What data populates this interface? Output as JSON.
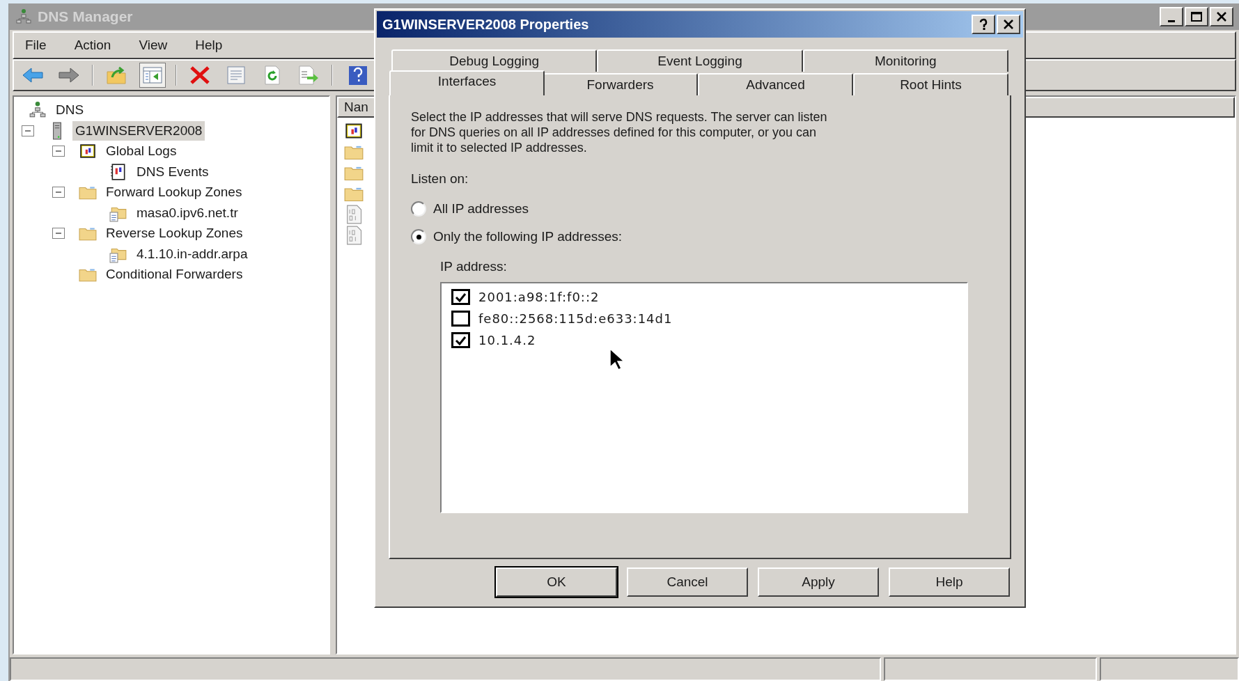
{
  "window": {
    "title": "DNS Manager"
  },
  "menu": [
    "File",
    "Action",
    "View",
    "Help"
  ],
  "toolbar": [
    {
      "kind": "back",
      "pressed": false
    },
    {
      "kind": "forward",
      "pressed": false
    },
    {
      "kind": "separator"
    },
    {
      "kind": "up",
      "pressed": false
    },
    {
      "kind": "tree-toggle",
      "pressed": true
    },
    {
      "kind": "separator"
    },
    {
      "kind": "delete",
      "pressed": false
    },
    {
      "kind": "properties",
      "pressed": false
    },
    {
      "kind": "refresh",
      "pressed": false
    },
    {
      "kind": "export",
      "pressed": false
    },
    {
      "kind": "separator"
    },
    {
      "kind": "help",
      "pressed": false
    }
  ],
  "tree": {
    "label": "DNS",
    "kind": "dns",
    "children": [
      {
        "label": "G1WINSERVER2008",
        "kind": "server",
        "selected": true,
        "expanded": true,
        "children": [
          {
            "label": "Global Logs",
            "kind": "log",
            "selected": false,
            "expanded": true,
            "children": [
              {
                "label": "DNS Events",
                "kind": "events",
                "selected": false
              }
            ]
          },
          {
            "label": "Forward Lookup Zones",
            "kind": "folder",
            "selected": false,
            "expanded": true,
            "children": [
              {
                "label": "masa0.ipv6.net.tr",
                "kind": "zone",
                "selected": false
              }
            ]
          },
          {
            "label": "Reverse Lookup Zones",
            "kind": "folder",
            "selected": false,
            "expanded": true,
            "children": [
              {
                "label": "4.1.10.in-addr.arpa",
                "kind": "zone",
                "selected": false
              }
            ]
          },
          {
            "label": "Conditional Forwarders",
            "kind": "folder",
            "selected": false
          }
        ]
      }
    ]
  },
  "list": {
    "column_1": "Nan",
    "items": [
      {
        "kind": "log"
      },
      {
        "kind": "folder"
      },
      {
        "kind": "folder"
      },
      {
        "kind": "folder"
      },
      {
        "kind": "binary"
      },
      {
        "kind": "binary"
      }
    ]
  },
  "dialog": {
    "title": "G1WINSERVER2008 Properties",
    "tab_rows": [
      {
        "tabs": [
          {
            "label": "Debug Logging",
            "selected": false
          },
          {
            "label": "Event Logging",
            "selected": false
          },
          {
            "label": "Monitoring",
            "selected": false
          }
        ]
      },
      {
        "tabs": [
          {
            "label": "Interfaces",
            "selected": true
          },
          {
            "label": "Forwarders",
            "selected": false
          },
          {
            "label": "Advanced",
            "selected": false
          },
          {
            "label": "Root Hints",
            "selected": false
          }
        ]
      }
    ],
    "description": "Select the IP addresses that will serve DNS requests. The server can listen for DNS queries on all IP addresses defined for this computer, or you can limit it to selected IP addresses.",
    "listen_label": "Listen on:",
    "options": [
      {
        "label": "All IP addresses",
        "selected": false
      },
      {
        "label": "Only the following IP addresses:",
        "selected": true
      }
    ],
    "ip_label": "IP address:",
    "addresses": [
      {
        "label": "2001:a98:1f:f0::2",
        "checked": true
      },
      {
        "label": "fe80::2568:115d:e633:14d1",
        "checked": false
      },
      {
        "label": "10.1.4.2",
        "checked": true
      }
    ],
    "buttons": [
      {
        "label": "OK",
        "default": true
      },
      {
        "label": "Cancel",
        "default": false
      },
      {
        "label": "Apply",
        "default": false
      },
      {
        "label": "Help",
        "default": false
      }
    ]
  }
}
